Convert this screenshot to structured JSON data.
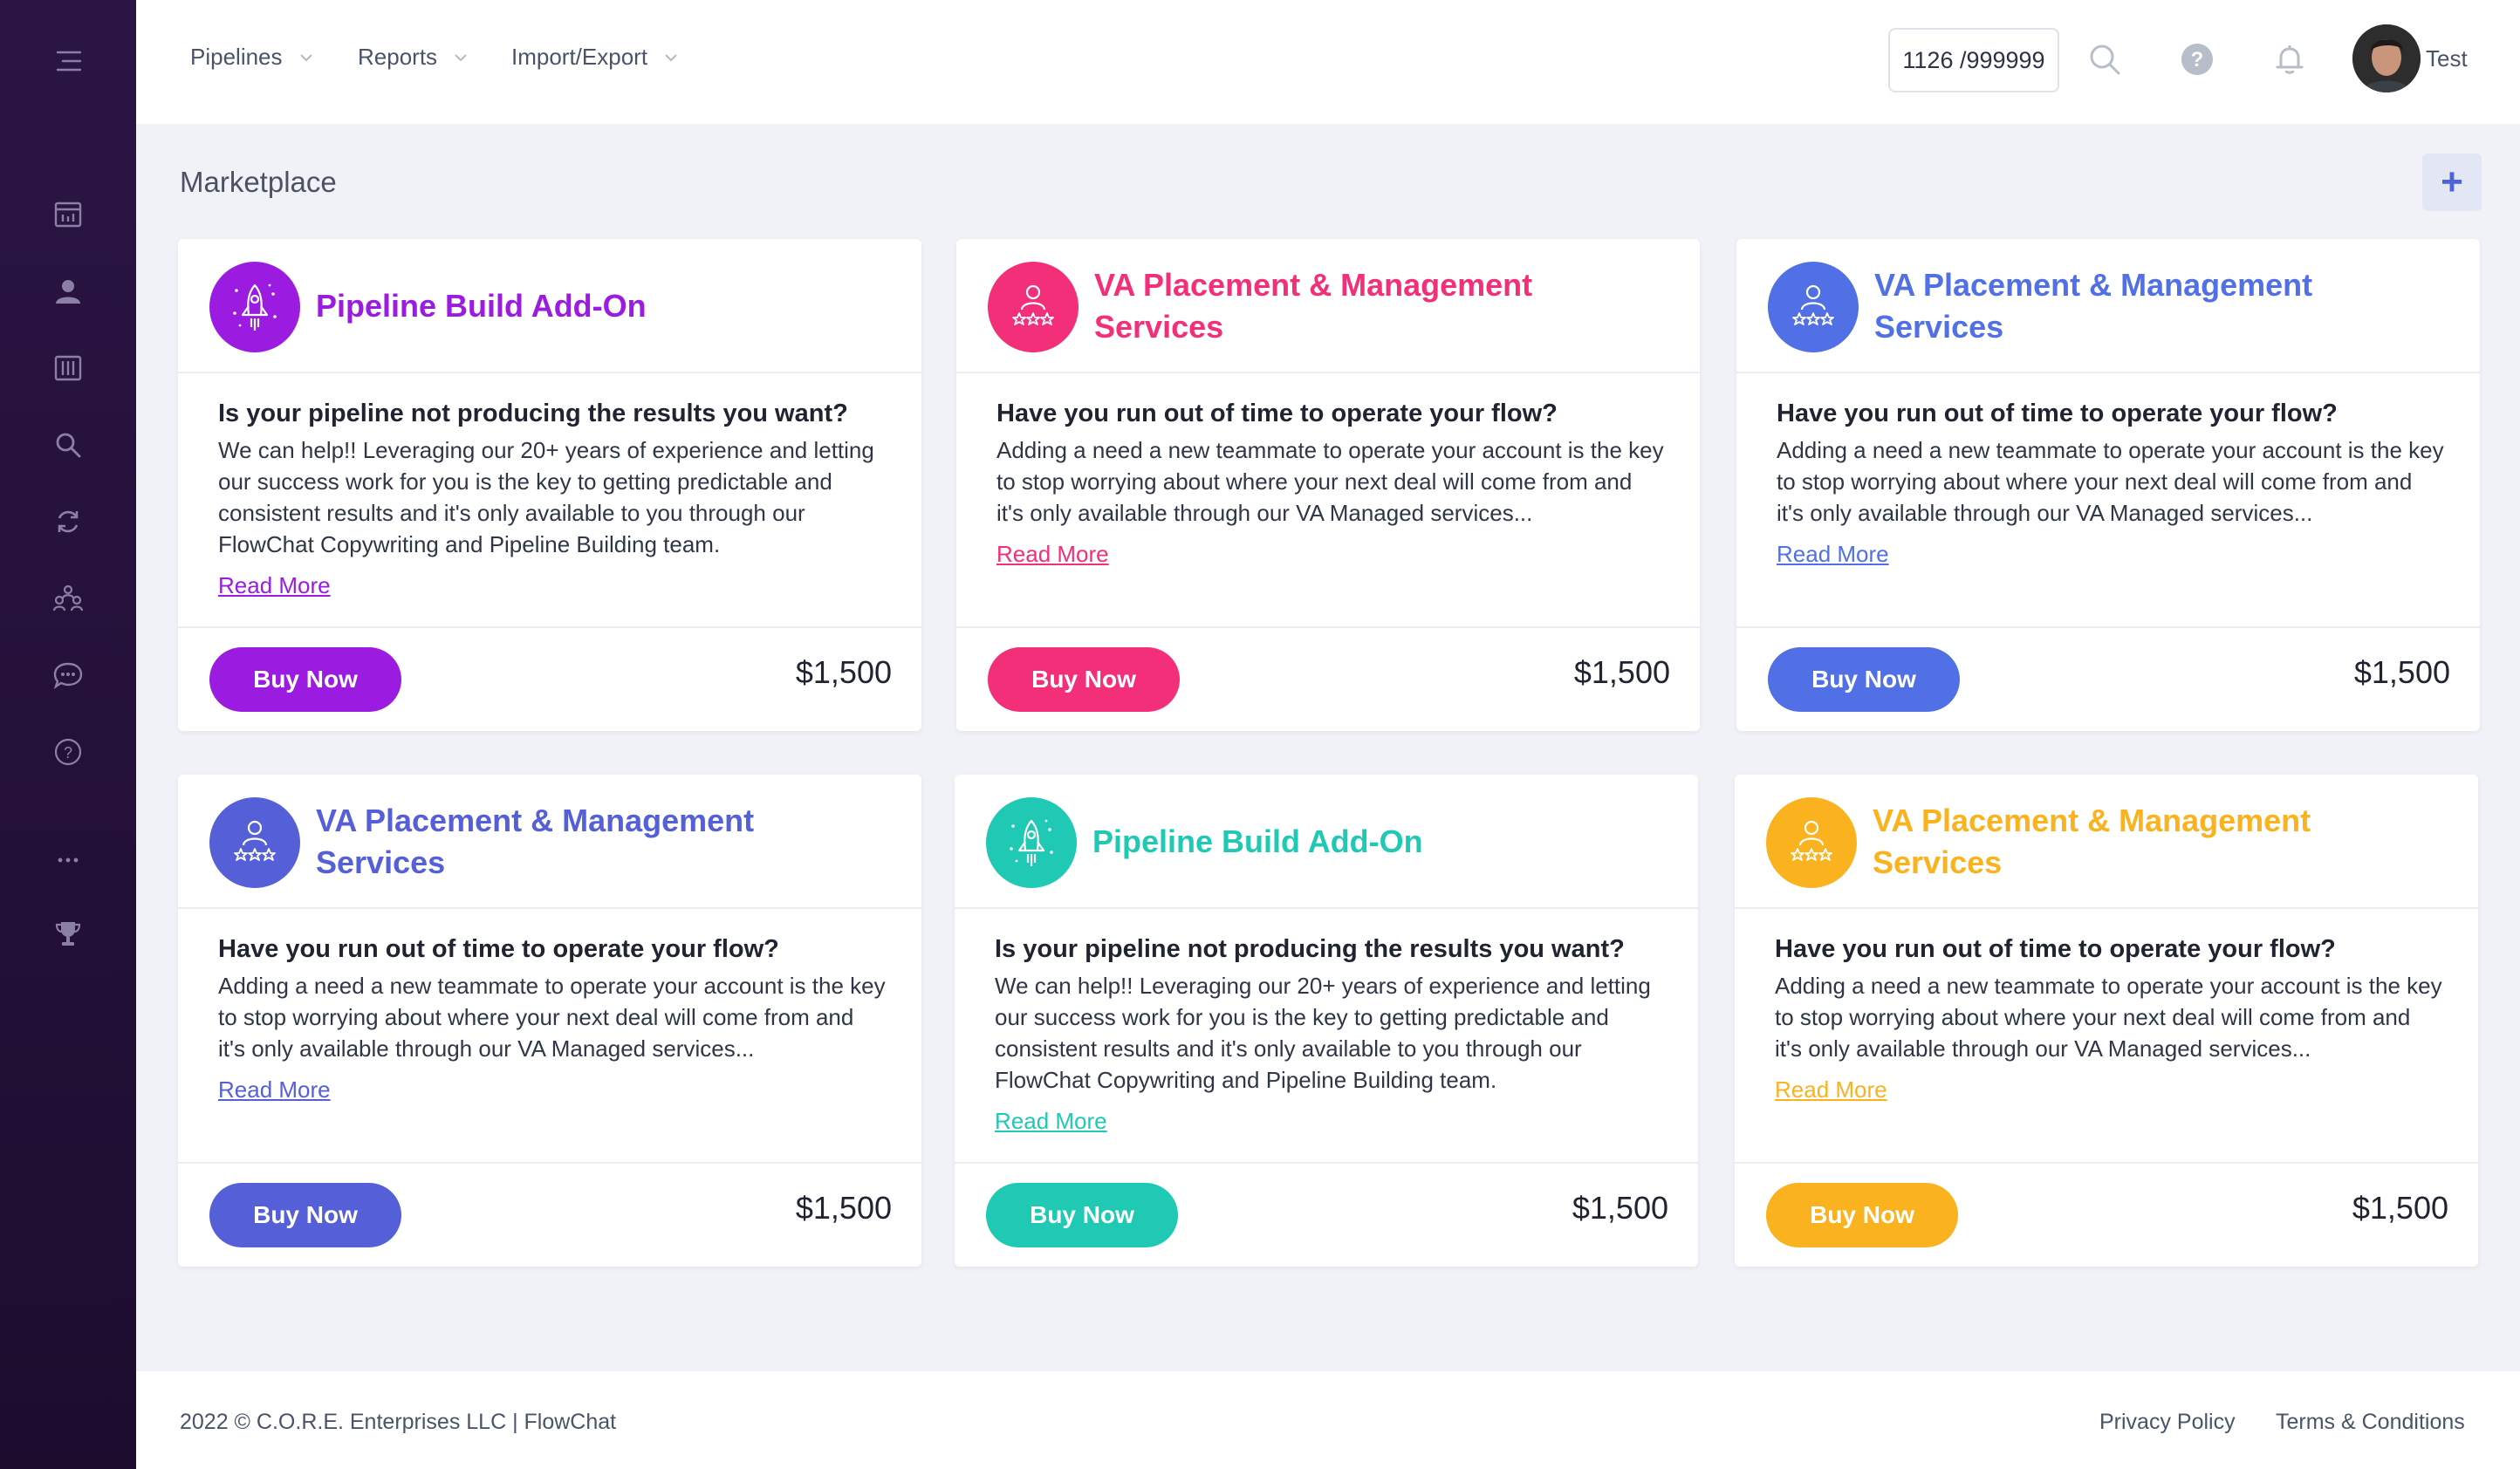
{
  "nav": {
    "items": [
      {
        "label": "Pipelines"
      },
      {
        "label": "Reports"
      },
      {
        "label": "Import/Export"
      }
    ]
  },
  "header": {
    "counter": "1126 /999999",
    "user_name": "Test"
  },
  "page": {
    "title": "Marketplace",
    "add_label": "+"
  },
  "cards": [
    {
      "title": "Pipeline Build Add-On",
      "color": "#9b1be0",
      "icon": "rocket-icon",
      "question": "Is your pipeline not producing the results you want?",
      "description": "We can help!! Leveraging our 20+ years of experience and letting our success work for you is the key to getting predictable and consistent results and it's only available to you through our FlowChat Copywriting and Pipeline Building team.",
      "read_more": "Read More",
      "buy_label": "Buy Now",
      "price": "$1,500"
    },
    {
      "title": "VA Placement & Management Services",
      "color": "#f22f78",
      "icon": "person-stars-icon",
      "question": "Have you run out of time to operate your flow?",
      "description": "Adding a need a new teammate to operate your account is the key to stop worrying about where your next deal will come from and it's only available through our VA Managed services...",
      "read_more": "Read More",
      "buy_label": "Buy Now",
      "price": "$1,500"
    },
    {
      "title": "VA Placement & Management Services",
      "color": "#5170e6",
      "icon": "person-stars-icon",
      "question": "Have you run out of time to operate your flow?",
      "description": "Adding a need a new teammate to operate your account is the key to stop worrying about where your next deal will come from and it's only available through our VA Managed services...",
      "read_more": "Read More",
      "buy_label": "Buy Now",
      "price": "$1,500"
    },
    {
      "title": "VA Placement & Management Services",
      "color": "#5560d8",
      "icon": "person-stars-icon",
      "question": "Have you run out of time to operate your flow?",
      "description": "Adding a need a new teammate to operate your account is the key to stop worrying about where your next deal will come from and it's only available through our VA Managed services...",
      "read_more": "Read More",
      "buy_label": "Buy Now",
      "price": "$1,500"
    },
    {
      "title": "Pipeline Build Add-On",
      "color": "#1fc9b3",
      "icon": "rocket-icon",
      "question": "Is your pipeline not producing the results you want?",
      "description": "We can help!! Leveraging our 20+ years of experience and letting our success work for you is the key to getting predictable and consistent results and it's only available to you through our FlowChat Copywriting and Pipeline Building team.",
      "read_more": "Read More",
      "buy_label": "Buy Now",
      "price": "$1,500"
    },
    {
      "title": "VA Placement & Management Services",
      "color": "#fbb21f",
      "icon": "person-stars-icon",
      "question": "Have you run out of time to operate your flow?",
      "description": "Adding a need a new teammate to operate your account is the key to stop worrying about where your next deal will come from and it's only available through our VA Managed services...",
      "read_more": "Read More",
      "buy_label": "Buy Now",
      "price": "$1,500"
    }
  ],
  "footer": {
    "copyright": "2022 © C.O.R.E. Enterprises LLC | FlowChat",
    "privacy": "Privacy Policy",
    "terms": "Terms & Conditions"
  }
}
